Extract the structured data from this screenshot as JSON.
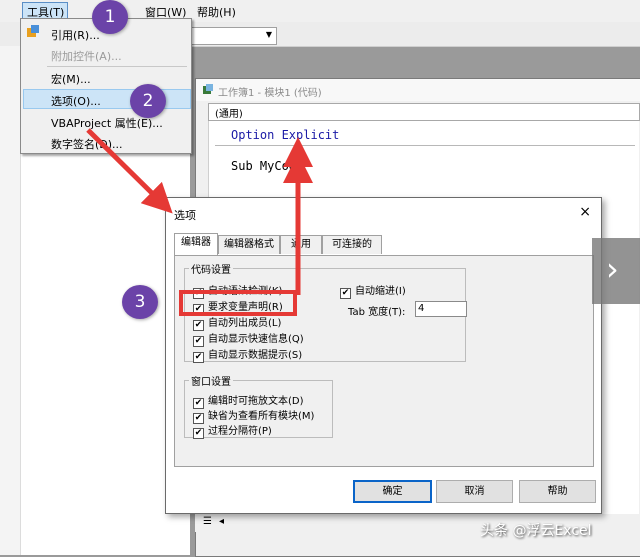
{
  "menubar": {
    "tools": "工具(T)",
    "window": "窗口(W)",
    "help": "帮助(H)"
  },
  "tools_menu": {
    "items": [
      {
        "label": "引用(R)...",
        "enabled": true
      },
      {
        "label": "附加控件(A)...",
        "enabled": false
      },
      {
        "label": "宏(M)...",
        "enabled": true
      },
      {
        "label": "选项(O)...",
        "enabled": true,
        "highlighted": true
      },
      {
        "label": "VBAProject 属性(E)...",
        "enabled": true
      },
      {
        "label": "数字签名(D)...",
        "enabled": true
      }
    ]
  },
  "code_window": {
    "title": "工作簿1 - 模块1 (代码)",
    "scope": "(通用)",
    "line1": "Option Explicit",
    "line2": "Sub MyCode"
  },
  "dialog": {
    "title": "选项",
    "close": "×",
    "tabs": [
      "编辑器",
      "编辑器格式",
      "通用",
      "可连接的"
    ],
    "code_settings_label": "代码设置",
    "code_settings": [
      {
        "label": "自动语法检测(K)",
        "checked": true
      },
      {
        "label": "要求变量声明(R)",
        "checked": true
      },
      {
        "label": "自动列出成员(L)",
        "checked": true
      },
      {
        "label": "自动显示快速信息(Q)",
        "checked": true
      },
      {
        "label": "自动显示数据提示(S)",
        "checked": true
      }
    ],
    "auto_indent": {
      "label": "自动缩进(I)",
      "checked": true
    },
    "tab_width_label": "Tab 宽度(T):",
    "tab_width_value": "4",
    "window_settings_label": "窗口设置",
    "window_settings": [
      {
        "label": "编辑时可拖放文本(D)",
        "checked": true
      },
      {
        "label": "缺省为查看所有模块(M)",
        "checked": true
      },
      {
        "label": "过程分隔符(P)",
        "checked": true
      }
    ],
    "buttons": {
      "ok": "确定",
      "cancel": "取消",
      "help": "帮助"
    }
  },
  "annotations": {
    "badge1": "1",
    "badge2": "2",
    "badge3": "3"
  },
  "watermark": "头条 @浮云Excel",
  "colors": {
    "badge": "#6b43a8",
    "arrow": "#e53935",
    "highlight": "#cce4f7"
  }
}
